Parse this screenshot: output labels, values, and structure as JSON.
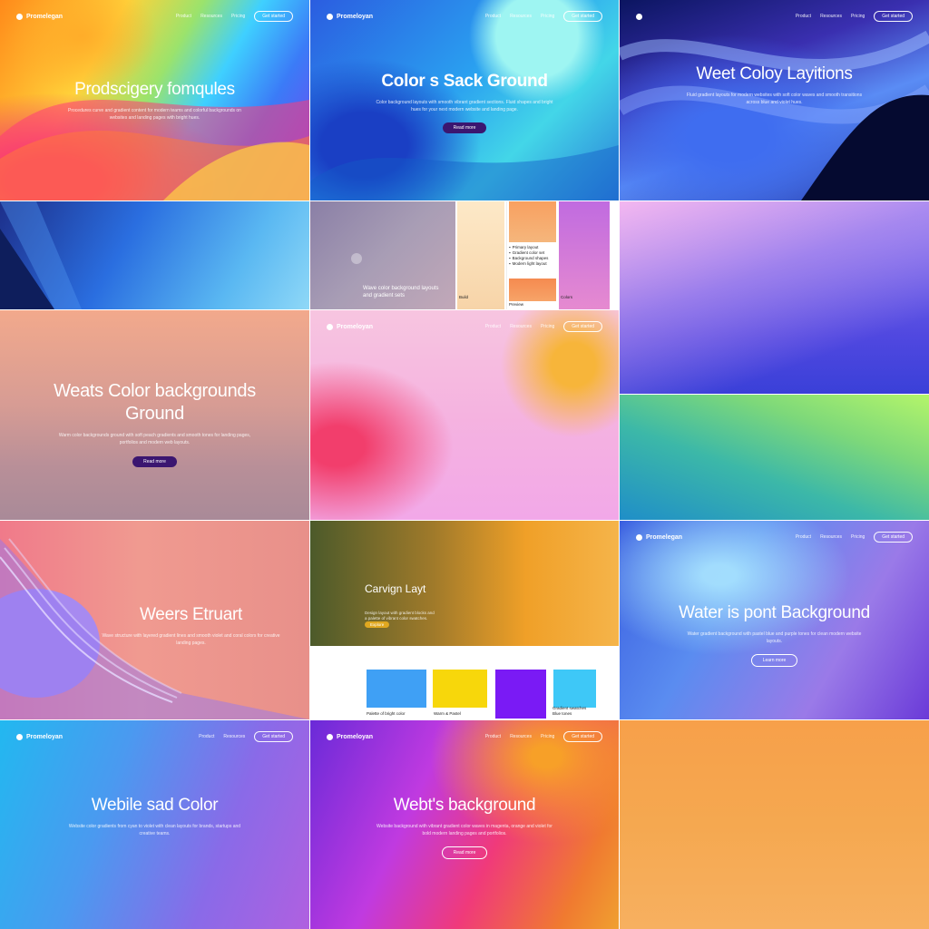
{
  "tiles": {
    "t1": {
      "logo": "Promelegan",
      "links": [
        "Product",
        "Resources",
        "Pricing"
      ],
      "nav_button": "Get started",
      "title": "Prodscigery fomqules",
      "body": "Procedures curve and gradient content for modern teams and colorful backgrounds on websites and landing pages with bright hues."
    },
    "t2": {
      "logo": "Promeloyan",
      "links": [
        "Product",
        "Resources",
        "Pricing"
      ],
      "nav_button": "Get started",
      "title": "Color s Sack Ground",
      "body": "Color background layouts with smooth vibrant gradient sections. Fluid shapes and bright hues for your next modern website and landing page.",
      "cta": "Read more"
    },
    "t3": {
      "links": [
        "Product",
        "Resources",
        "Pricing"
      ],
      "nav_button": "Get started",
      "title": "Weet Coloy Layitions",
      "body": "Fluid gradient layouts for modern websites with soft color waves and smooth transitions across blue and violet hues."
    },
    "t5": {
      "body": "Wave color background layouts and gradient sets",
      "list": [
        "Primary layout",
        "Gradient color set",
        "Background shapes",
        "Modern light layout"
      ],
      "captions": [
        "Build",
        "Preview",
        "Colors"
      ]
    },
    "t7": {
      "title": "Weats Color backgrounds Ground",
      "body": "Warm color backgrounds ground with soft peach gradients and smooth tones for landing pages, portfolios and modern web layouts.",
      "cta": "Read more"
    },
    "t8": {
      "logo": "Promeloyan",
      "links": [
        "Product",
        "Resources",
        "Pricing"
      ],
      "nav_button": "Get started"
    },
    "t10": {
      "title": "Weers Etruart",
      "body": "Wave structure with layered gradient lines and smooth violet and coral colors for creative landing pages."
    },
    "t11": {
      "title": "Carvign Layt",
      "body": "Design layout with gradient blocks and a palette of vibrant color swatches.",
      "cta": "Explore",
      "captions": [
        "Palette of bright color",
        "Warm & Pastel",
        "Gradient swatches",
        "Blue tones"
      ]
    },
    "t12": {
      "logo": "Promelegan",
      "links": [
        "Product",
        "Resources",
        "Pricing"
      ],
      "nav_button": "Get started",
      "title": "Water is pont Background",
      "body": "Water gradient background with pastel blue and purple tones for clean modern website layouts.",
      "cta": "Learn more"
    },
    "t13": {
      "logo": "Promeloyan",
      "links": [
        "Product",
        "Resources"
      ],
      "nav_button": "Get started",
      "title": "Webile sad Color",
      "body": "Website color gradients from cyan to violet with clean layouts for brands, startups and creative teams."
    },
    "t14": {
      "logo": "Promeloyan",
      "links": [
        "Product",
        "Resources",
        "Pricing"
      ],
      "nav_button": "Get started",
      "title": "Webt's background",
      "body": "Website background with vibrant gradient color waves in magenta, orange and violet for bold modern landing pages and portfolios.",
      "cta": "Read more"
    }
  },
  "swatch_colors": [
    "#3fa0f5",
    "#f7d70b",
    "#7a1af5",
    "#3ec8f7"
  ],
  "icons": [
    "logo-dot",
    "play-icon",
    "list-bullet-icon"
  ]
}
